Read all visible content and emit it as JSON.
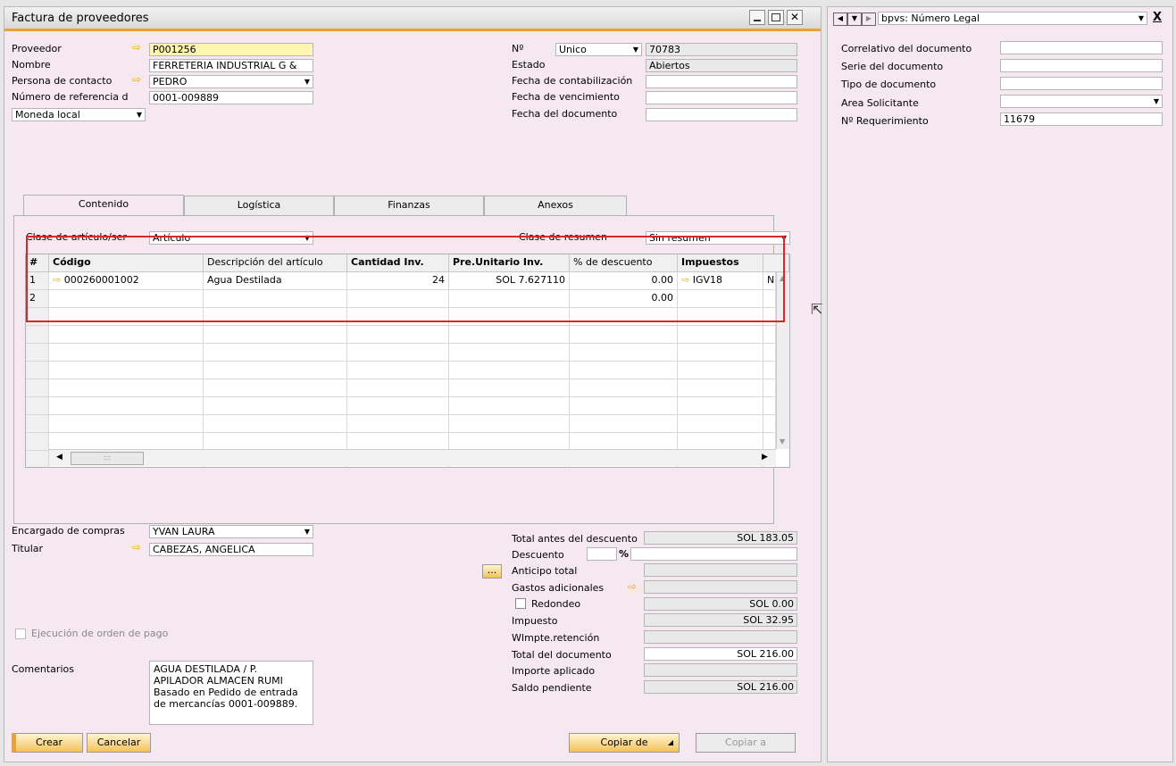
{
  "window": {
    "title": "Factura de proveedores"
  },
  "header": {
    "proveedor_label": "Proveedor",
    "proveedor_value": "P001256",
    "nombre_label": "Nombre",
    "nombre_value": "FERRETERIA INDUSTRIAL G &",
    "contacto_label": "Persona de contacto",
    "contacto_value": "PEDRO",
    "referencia_label": "Número de referencia d",
    "referencia_value": "0001-009889",
    "moneda_value": "Moneda local",
    "no_label": "Nº",
    "no_series": "Unico",
    "no_value": "70783",
    "estado_label": "Estado",
    "estado_value": "Abiertos",
    "fecha_contab_label": "Fecha de contabilización",
    "fecha_contab_value": "",
    "fecha_venc_label": "Fecha de vencimiento",
    "fecha_venc_value": "",
    "fecha_doc_label": "Fecha del documento",
    "fecha_doc_value": ""
  },
  "tabs": [
    {
      "label": "Contenido"
    },
    {
      "label": "Logística"
    },
    {
      "label": "Finanzas"
    },
    {
      "label": "Anexos"
    }
  ],
  "content": {
    "clase_label": "Clase de artículo/ser",
    "clase_value": "Artículo",
    "resumen_label": "Clase de resumen",
    "resumen_value": "Sin resumen",
    "columns": [
      "#",
      "Código",
      "Descripción del artículo",
      "Cantidad Inv.",
      "Pre.Unitario Inv.",
      "% de descuento",
      "Impuestos"
    ],
    "rows": [
      {
        "num": "1",
        "codigo": "000260001002",
        "descripcion": "Agua Destilada",
        "cantidad": "24",
        "precio": "SOL 7.627110",
        "descuento": "0.00",
        "impuesto": "IGV18",
        "extra": "N"
      },
      {
        "num": "2",
        "codigo": "",
        "descripcion": "",
        "cantidad": "",
        "precio": "",
        "descuento": "0.00",
        "impuesto": "",
        "extra": ""
      }
    ],
    "scroll_grip": ":::"
  },
  "footer": {
    "encargado_label": "Encargado de compras",
    "encargado_value": "YVAN LAURA",
    "titular_label": "Titular",
    "titular_value": "CABEZAS, ANGELICA",
    "ejecucion_label": "Ejecución de orden de pago",
    "comentarios_label": "Comentarios",
    "comentarios_value": "AGUA DESTILADA / P. APILADOR ALMACEN RUMI Basado en Pedido de entrada de mercancías 0001-009889.",
    "total_antes_label": "Total antes del descuento",
    "total_antes_value": "SOL 183.05",
    "descuento_label": "Descuento",
    "descuento_pct": "%",
    "anticipo_label": "Anticipo total",
    "gastos_label": "Gastos adicionales",
    "redondeo_label": "Redondeo",
    "redondeo_value": "SOL 0.00",
    "impuesto_label": "Impuesto",
    "impuesto_value": "SOL 32.95",
    "wimpte_label": "WImpte.retención",
    "total_doc_label": "Total del documento",
    "total_doc_value": "SOL 216.00",
    "importe_label": "Importe aplicado",
    "saldo_label": "Saldo pendiente",
    "saldo_value": "SOL 216.00",
    "dots": "..."
  },
  "buttons": {
    "crear": "Crear",
    "cancelar": "Cancelar",
    "copiar_de": "Copiar de",
    "copiar_a": "Copiar a"
  },
  "side": {
    "title": "bpvs: Número Legal",
    "fields": [
      {
        "label": "Correlativo del documento",
        "value": ""
      },
      {
        "label": "Serie del documento",
        "value": ""
      },
      {
        "label": "Tipo de documento",
        "value": ""
      },
      {
        "label": "Area Solicitante",
        "value": ""
      },
      {
        "label": "Nº Requerimiento",
        "value": "11679"
      }
    ],
    "close": "X"
  },
  "colors": {
    "accent": "#f0a030",
    "highlight": "#d62828",
    "window_bg": "#f6e8f1"
  }
}
